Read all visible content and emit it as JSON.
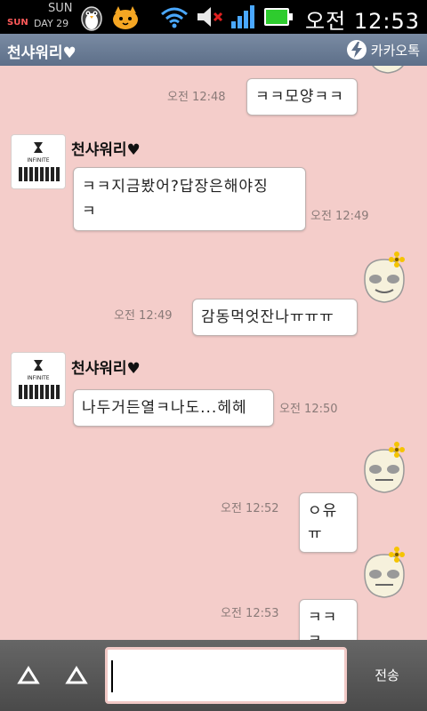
{
  "status_bar": {
    "widget_sun_small": "SUN",
    "widget_sun": "SUN",
    "widget_day": "DAY 29",
    "time": "오전 12:53",
    "icons": [
      "penguin-icon",
      "cat-icon",
      "wifi-icon",
      "mute-icon",
      "signal-icon",
      "battery-icon"
    ]
  },
  "header": {
    "title": "천샤워리♥",
    "kakao_label": "카카오톡"
  },
  "messages": [
    {
      "side": "me",
      "text": "ㅋㅋ모양ㅋㅋ",
      "time": "오전 12:48"
    },
    {
      "side": "other",
      "sender": "천샤워리♥",
      "text_line1": "ㅋㅋ지금봤어?답장은해야징",
      "text_line2": "ㅋ",
      "time": "오전 12:49"
    },
    {
      "side": "me",
      "text": "감동먹엇잔나ㅠㅠㅠ",
      "time": "오전 12:49"
    },
    {
      "side": "other",
      "sender": "천샤워리♥",
      "text": "나두거든열ㅋ나도...헤헤",
      "time": "오전 12:50"
    },
    {
      "side": "me",
      "text": "ㅇ유ㅠ",
      "time": "오전 12:52"
    },
    {
      "side": "me",
      "text": "ㅋㅋㅋ",
      "time": "오전 12:53"
    }
  ],
  "profile_label": "INFINITE",
  "bottom": {
    "send_label": "전송",
    "input_value": ""
  },
  "colors": {
    "chat_bg": "#f4cdca",
    "title_bar": "#6a7c96",
    "bottom_bar": "#555555"
  }
}
